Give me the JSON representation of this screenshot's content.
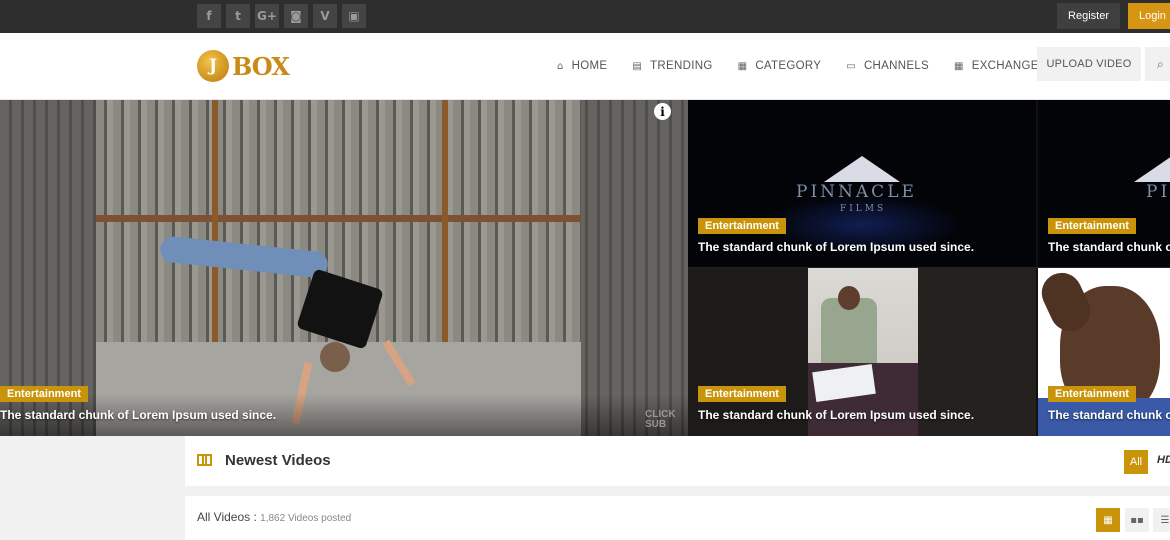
{
  "topbar": {
    "social_icons": [
      "facebook-icon",
      "twitter-icon",
      "google-plus-icon",
      "instagram-icon",
      "vimeo-icon",
      "youtube-icon"
    ],
    "social_glyphs": [
      "f",
      "t",
      "G+",
      "◙",
      "V",
      "▣"
    ],
    "register_label": "Register",
    "login_label": "Login"
  },
  "header": {
    "logo_text": "BOX",
    "logo_coin": "J",
    "nav": [
      {
        "label": "HOME",
        "icon": "home-icon",
        "glyph": "⌂"
      },
      {
        "label": "TRENDING",
        "icon": "film-icon",
        "glyph": "▤"
      },
      {
        "label": "CATEGORY",
        "icon": "grid-icon",
        "glyph": "▦"
      },
      {
        "label": "CHANNELS",
        "icon": "monitor-icon",
        "glyph": "▭"
      },
      {
        "label": "EXCHANGER",
        "icon": "calculator-icon",
        "glyph": "▦"
      }
    ],
    "upload_label": "UPLOAD VIDEO",
    "search_glyph": "⌕"
  },
  "featured": [
    {
      "category": "Entertainment",
      "title": "The standard chunk of Lorem Ipsum used since."
    },
    {
      "category": "Entertainment",
      "title": "The standard chunk of Lorem Ipsum used since."
    },
    {
      "category": "Entertainment",
      "title": "The standard chunk o"
    },
    {
      "category": "Entertainment",
      "title": "The standard chunk of Lorem Ipsum used since."
    },
    {
      "category": "Entertainment",
      "title": "The standard chunk o"
    }
  ],
  "overlay": {
    "info_glyph": "i",
    "click_sub": "CLICK SUB",
    "pinnacle_a": "PINNACLE",
    "pinnacle_sub": "FILMS",
    "pinnacle_b": "PI"
  },
  "newest": {
    "title": "Newest Videos",
    "filter_all": "All",
    "filter_hd": "HD",
    "all_videos_label": "All Videos :",
    "count_text": "1,862 Videos posted"
  },
  "colors": {
    "accent": "#c9940a",
    "topbar": "#2e2e2e",
    "login": "#d69512"
  }
}
